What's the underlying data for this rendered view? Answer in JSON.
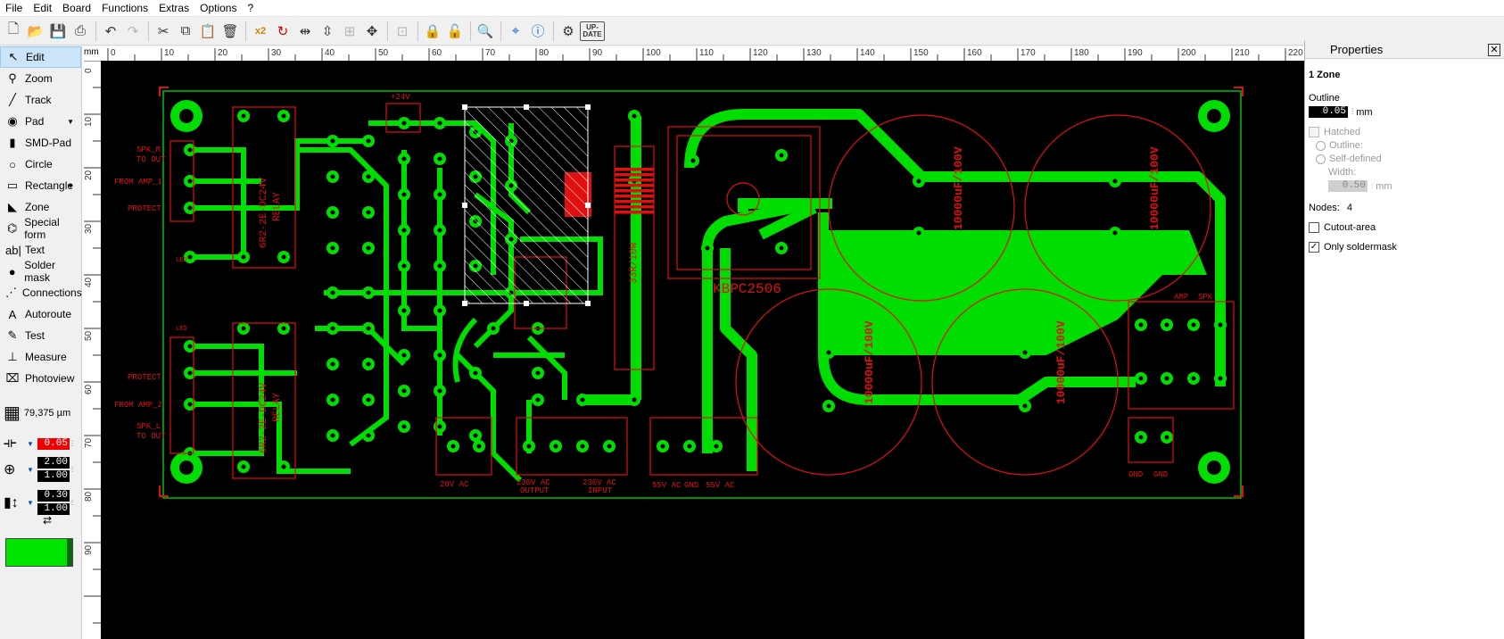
{
  "menu": [
    "File",
    "Edit",
    "Board",
    "Functions",
    "Extras",
    "Options",
    "?"
  ],
  "toolbar_icons": [
    "new-icon",
    "open-icon",
    "save-icon",
    "print-icon",
    "undo-icon",
    "redo-icon",
    "cut-icon",
    "copy-icon",
    "paste-icon",
    "delete-icon",
    "x2-icon",
    "rotate-icon",
    "mirror-horizontal-icon",
    "mirror-vertical-icon",
    "align-icon",
    "snap-icon",
    "group-icon",
    "lock-icon",
    "unlock-icon",
    "zoom-search-icon",
    "crosshair-icon",
    "info-icon",
    "settings-icon",
    "update-icon"
  ],
  "toolbar": {
    "x2": "x2",
    "update_line1": "UP-",
    "update_line2": "DATE"
  },
  "tools": [
    {
      "id": "edit",
      "label": "Edit",
      "icon": "cursor-icon",
      "glyph": "↖"
    },
    {
      "id": "zoom",
      "label": "Zoom",
      "icon": "zoom-icon",
      "glyph": "⚲"
    },
    {
      "id": "track",
      "label": "Track",
      "icon": "track-icon",
      "glyph": "╱"
    },
    {
      "id": "pad",
      "label": "Pad",
      "icon": "pad-icon",
      "glyph": "◉"
    },
    {
      "id": "smd-pad",
      "label": "SMD-Pad",
      "icon": "smd-pad-icon",
      "glyph": "▮"
    },
    {
      "id": "circle",
      "label": "Circle",
      "icon": "circle-icon",
      "glyph": "○"
    },
    {
      "id": "rectangle",
      "label": "Rectangle",
      "icon": "rectangle-icon",
      "glyph": "▭"
    },
    {
      "id": "zone",
      "label": "Zone",
      "icon": "zone-icon",
      "glyph": "◣"
    },
    {
      "id": "special-form",
      "label": "Special form",
      "icon": "special-form-icon",
      "glyph": "⌬"
    },
    {
      "id": "text",
      "label": "Text",
      "icon": "text-icon",
      "glyph": "ab|"
    },
    {
      "id": "solder-mask",
      "label": "Solder mask",
      "icon": "solder-mask-icon",
      "glyph": "●"
    },
    {
      "id": "connections",
      "label": "Connections",
      "icon": "connections-icon",
      "glyph": "⋰"
    },
    {
      "id": "autoroute",
      "label": "Autoroute",
      "icon": "autoroute-icon",
      "glyph": "A"
    },
    {
      "id": "test",
      "label": "Test",
      "icon": "test-icon",
      "glyph": "✎"
    },
    {
      "id": "measure",
      "label": "Measure",
      "icon": "measure-icon",
      "glyph": "⊥"
    },
    {
      "id": "photoview",
      "label": "Photoview",
      "icon": "photoview-icon",
      "glyph": "⌧"
    }
  ],
  "grid_value": "79,375 µm",
  "track_width": "0.05",
  "pad_outer": "2.00",
  "pad_inner": "1.00",
  "smd_w": "0.30",
  "smd_h": "1.00",
  "swap_glyph": "⇄",
  "ruler_unit": "mm",
  "ruler_top": [
    "0",
    "10",
    "20",
    "30",
    "40",
    "50",
    "60",
    "70",
    "80",
    "90",
    "100",
    "110",
    "120",
    "130",
    "140",
    "150",
    "160",
    "170",
    "180",
    "190",
    "200",
    "210",
    "220"
  ],
  "ruler_left": [
    "0",
    "10",
    "20",
    "30",
    "40",
    "50",
    "60",
    "70",
    "80",
    "90"
  ],
  "properties": {
    "title": "Properties",
    "close": "✕",
    "object": "1 Zone",
    "outline_label": "Outline",
    "outline_value": "0.05",
    "unit": "mm",
    "hatched": "Hatched",
    "outline_radio": "Outline:",
    "self_defined": "Self-defined",
    "width_label": "Width:",
    "width_value": "0.50",
    "nodes_label": "Nodes:",
    "nodes_value": "4",
    "cutout": "Cutout-area",
    "only_soldermask": "Only soldermask",
    "check": "✓"
  },
  "board_labels": {
    "spk_r": "SPK_R",
    "to_out_1": "TO OUT",
    "from_amp_1": "FROM AMP_1",
    "protect_1": "PROTECT",
    "protect_2": "PROTECT",
    "from_amp_2": "FROM AMP_2",
    "spk_l": "SPK_L",
    "to_out_2": "TO OUT",
    "plus24": "+24V",
    "relay_1": "RELAY",
    "relay_1_part": "6R2-2E-DC24V",
    "relay_2": "RELAY",
    "relay_2_part": "6R2-2E-DC24V",
    "bridge": "KBPC2506",
    "resistor": "33R/10W",
    "cap1": "10000uF/100V",
    "cap2": "10000uF/100V",
    "cap3": "10000uF/100V",
    "cap4": "10000uF/100V",
    "ac20": "20V AC",
    "ac230_out_1": "230V AC",
    "ac230_out_2": "OUTPUT",
    "ac230_in_1": "230V AC",
    "ac230_in_2": "INPUT",
    "ac55a": "55V AC",
    "gnd_mid": "GND",
    "ac55b": "55V AC",
    "amp": "AMP",
    "spk": "SPK",
    "gnd_a": "GND",
    "gnd_b": "GND",
    "led_1": "LED",
    "led_2": "LED"
  },
  "colors": {
    "board_bg": "#000000",
    "copper": "#00dd00",
    "silk": "#e01010",
    "outline": "#00c000"
  }
}
